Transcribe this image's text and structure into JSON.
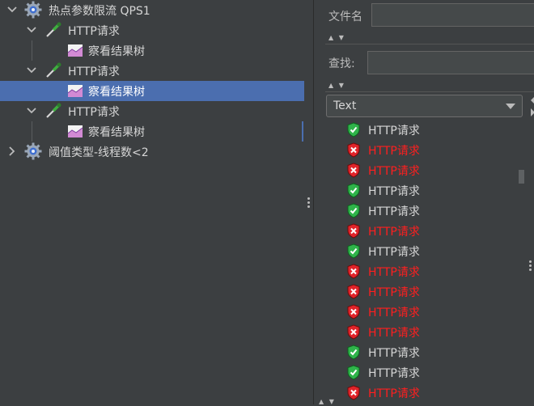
{
  "tree": {
    "nodes": [
      {
        "label": "热点参数限流 QPS1",
        "icon": "gear-icon",
        "expanded": true
      },
      {
        "label": "HTTP请求",
        "icon": "pipette-icon",
        "expanded": true
      },
      {
        "label": "察看结果树",
        "icon": "chart-icon"
      },
      {
        "label": "HTTP请求",
        "icon": "pipette-icon",
        "expanded": true
      },
      {
        "label": "察看结果树",
        "icon": "chart-icon",
        "selected": true
      },
      {
        "label": "HTTP请求",
        "icon": "pipette-icon",
        "expanded": true
      },
      {
        "label": "察看结果树",
        "icon": "chart-icon"
      },
      {
        "label": "阈值类型-线程数<2",
        "icon": "gear-icon",
        "expanded": false
      }
    ]
  },
  "panel": {
    "filename_label": "文件名",
    "filename_value": "",
    "search_label": "查找:",
    "search_value": "",
    "renderer_selected": "Text"
  },
  "results": [
    {
      "label": "HTTP请求",
      "status": "success"
    },
    {
      "label": "HTTP请求",
      "status": "failure"
    },
    {
      "label": "HTTP请求",
      "status": "failure"
    },
    {
      "label": "HTTP请求",
      "status": "success"
    },
    {
      "label": "HTTP请求",
      "status": "success"
    },
    {
      "label": "HTTP请求",
      "status": "failure"
    },
    {
      "label": "HTTP请求",
      "status": "success"
    },
    {
      "label": "HTTP请求",
      "status": "failure"
    },
    {
      "label": "HTTP请求",
      "status": "failure"
    },
    {
      "label": "HTTP请求",
      "status": "failure"
    },
    {
      "label": "HTTP请求",
      "status": "failure"
    },
    {
      "label": "HTTP请求",
      "status": "success"
    },
    {
      "label": "HTTP请求",
      "status": "success"
    },
    {
      "label": "HTTP请求",
      "status": "failure"
    }
  ],
  "colors": {
    "background": "#3c3f41",
    "selection": "#4b6eaf",
    "success_green": "#2fb34a",
    "failure_red": "#e0242a"
  }
}
